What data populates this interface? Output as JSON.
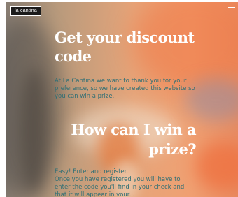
{
  "header": {
    "logo_text": "la cantina",
    "menu_icon": "hamburger-menu-icon"
  },
  "hero": {
    "title": "Get your discount code",
    "intro": "At La Cantina we want to thank you for your preference, so we have created this website so you can win a prize."
  },
  "how": {
    "title": "How can I win a prize?",
    "line1": "Easy! Enter and register.",
    "line2": "Once you have registered you will have to enter the code you'll find in your check and that it will appear in your..."
  },
  "colors": {
    "title": "#ffffff",
    "body_text": "#2f6f75",
    "logo_bg": "#1b1b1b"
  }
}
